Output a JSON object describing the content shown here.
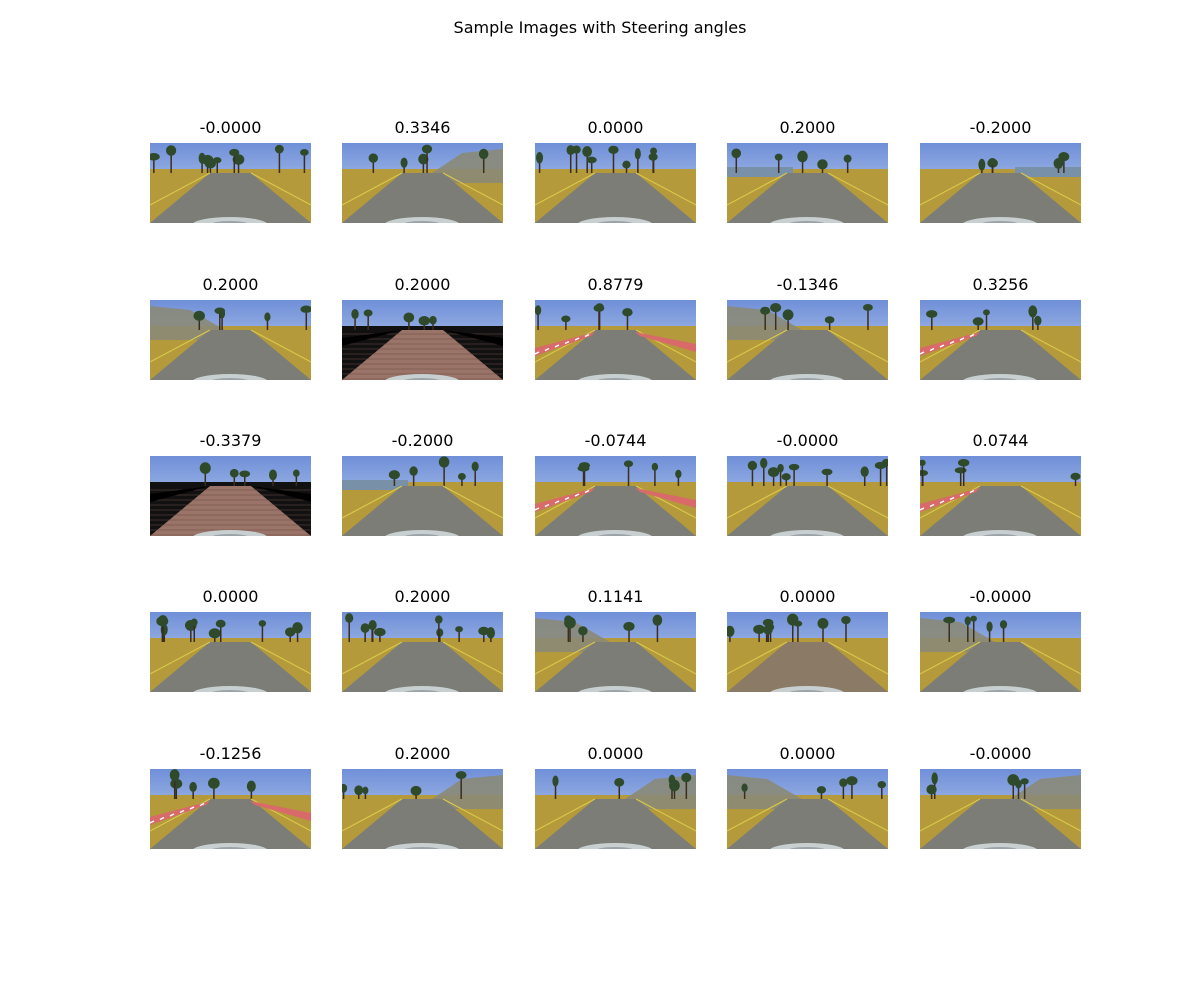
{
  "figure": {
    "suptitle": "Sample Images with Steering angles",
    "rows": 5,
    "cols": 5,
    "images": [
      {
        "angle": "-0.0000",
        "scene": "asphalt-trees-left"
      },
      {
        "angle": "0.3346",
        "scene": "asphalt-hill-right"
      },
      {
        "angle": "0.0000",
        "scene": "asphalt-trees"
      },
      {
        "angle": "0.2000",
        "scene": "asphalt-lake"
      },
      {
        "angle": "-0.2000",
        "scene": "asphalt-lake-right"
      },
      {
        "angle": "0.2000",
        "scene": "asphalt-rock-left"
      },
      {
        "angle": "0.2000",
        "scene": "bridge-brick"
      },
      {
        "angle": "0.8779",
        "scene": "curve-red-curbs"
      },
      {
        "angle": "-0.1346",
        "scene": "asphalt-hill"
      },
      {
        "angle": "0.3256",
        "scene": "curve-red-curbs-left"
      },
      {
        "angle": "-0.3379",
        "scene": "bridge-brick"
      },
      {
        "angle": "-0.2000",
        "scene": "asphalt-lake"
      },
      {
        "angle": "-0.0744",
        "scene": "curve-red-curbs"
      },
      {
        "angle": "-0.0000",
        "scene": "asphalt-trees"
      },
      {
        "angle": "0.0744",
        "scene": "curve-red-curbs-left"
      },
      {
        "angle": "0.0000",
        "scene": "asphalt-trees"
      },
      {
        "angle": "0.2000",
        "scene": "asphalt-trees"
      },
      {
        "angle": "0.1141",
        "scene": "asphalt-hill-left"
      },
      {
        "angle": "0.0000",
        "scene": "dirt-trees"
      },
      {
        "angle": "-0.0000",
        "scene": "asphalt-hill-left"
      },
      {
        "angle": "-0.1256",
        "scene": "curve-red-curbs"
      },
      {
        "angle": "0.2000",
        "scene": "asphalt-hill-right"
      },
      {
        "angle": "0.0000",
        "scene": "asphalt-hill-right"
      },
      {
        "angle": "0.0000",
        "scene": "asphalt-hill"
      },
      {
        "angle": "-0.0000",
        "scene": "asphalt-rock-right"
      }
    ]
  }
}
